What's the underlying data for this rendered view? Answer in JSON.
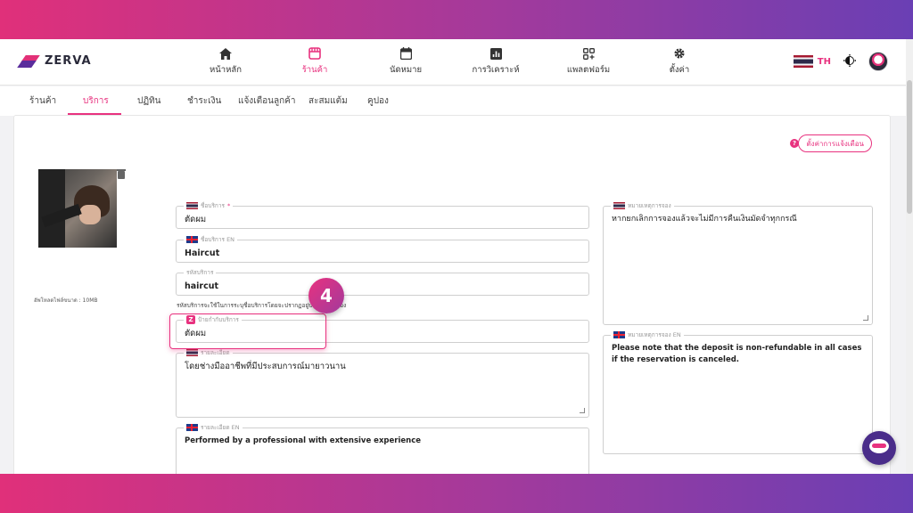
{
  "brand": {
    "name": "ZERVA"
  },
  "nav": [
    {
      "label": "หน้าหลัก",
      "icon": "home-icon"
    },
    {
      "label": "ร้านค้า",
      "icon": "store-icon",
      "active": true
    },
    {
      "label": "นัดหมาย",
      "icon": "calendar-icon"
    },
    {
      "label": "การวิเคราะห์",
      "icon": "chart-icon"
    },
    {
      "label": "แพลตฟอร์ม",
      "icon": "apps-icon"
    },
    {
      "label": "ตั้งค่า",
      "icon": "gear-icon"
    }
  ],
  "language": {
    "code": "TH"
  },
  "tabs": [
    {
      "label": "ร้านค้า"
    },
    {
      "label": "บริการ",
      "active": true
    },
    {
      "label": "ปฏิทิน"
    },
    {
      "label": "ชำระเงิน"
    },
    {
      "label": "แจ้งเตือนลูกค้า"
    },
    {
      "label": "สะสมแต้ม"
    },
    {
      "label": "คูปอง"
    }
  ],
  "notification_settings_label": "ตั้งค่าการแจ้งเตือน",
  "upload_note": "อัพโหลดไฟล์ขนาด : 10MB",
  "form": {
    "name_th": {
      "label": "ชื่อบริการ",
      "required_mark": "*",
      "value": "ตัดผม"
    },
    "name_en": {
      "label": "ชื่อบริการ EN",
      "value": "Haircut"
    },
    "code": {
      "label": "รหัสบริการ",
      "value": "haircut",
      "hint": "รหัสบริการจะใช้ในการระบุชื่อบริการโดยจะปรากฏอยู่บนลิงค์การจอง"
    },
    "display_name": {
      "label": "ป้ายกำกับบริการ",
      "value": "ตัดผม"
    },
    "detail_th": {
      "label": "รายละเอียด",
      "value": "โดยช่างมืออาชีพที่มีประสบการณ์มายาวนาน"
    },
    "detail_en": {
      "label": "รายละเอียด EN",
      "value": "Performed by a professional with extensive experience"
    },
    "booking_note_th": {
      "label": "หมายเหตุการจอง",
      "value": "หากยกเลิกการจองแล้วจะไม่มีการคืนเงินมัดจำทุกกรณี"
    },
    "booking_note_en": {
      "label": "หมายเหตุการจอง EN",
      "value": "Please note that the deposit is non-refundable in all cases if the reservation is canceled."
    }
  },
  "step_badge": "4",
  "colors": {
    "accent": "#e8327f",
    "brand_purple": "#5a2d9c"
  }
}
